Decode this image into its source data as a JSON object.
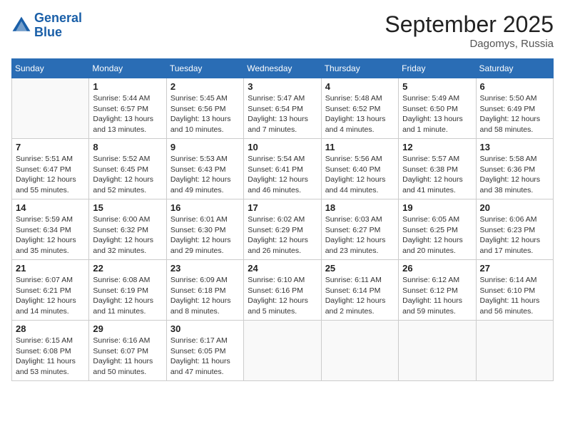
{
  "header": {
    "logo_line1": "General",
    "logo_line2": "Blue",
    "month": "September 2025",
    "location": "Dagomys, Russia"
  },
  "weekdays": [
    "Sunday",
    "Monday",
    "Tuesday",
    "Wednesday",
    "Thursday",
    "Friday",
    "Saturday"
  ],
  "weeks": [
    [
      {
        "day": "",
        "sunrise": "",
        "sunset": "",
        "daylight": ""
      },
      {
        "day": "1",
        "sunrise": "Sunrise: 5:44 AM",
        "sunset": "Sunset: 6:57 PM",
        "daylight": "Daylight: 13 hours and 13 minutes."
      },
      {
        "day": "2",
        "sunrise": "Sunrise: 5:45 AM",
        "sunset": "Sunset: 6:56 PM",
        "daylight": "Daylight: 13 hours and 10 minutes."
      },
      {
        "day": "3",
        "sunrise": "Sunrise: 5:47 AM",
        "sunset": "Sunset: 6:54 PM",
        "daylight": "Daylight: 13 hours and 7 minutes."
      },
      {
        "day": "4",
        "sunrise": "Sunrise: 5:48 AM",
        "sunset": "Sunset: 6:52 PM",
        "daylight": "Daylight: 13 hours and 4 minutes."
      },
      {
        "day": "5",
        "sunrise": "Sunrise: 5:49 AM",
        "sunset": "Sunset: 6:50 PM",
        "daylight": "Daylight: 13 hours and 1 minute."
      },
      {
        "day": "6",
        "sunrise": "Sunrise: 5:50 AM",
        "sunset": "Sunset: 6:49 PM",
        "daylight": "Daylight: 12 hours and 58 minutes."
      }
    ],
    [
      {
        "day": "7",
        "sunrise": "Sunrise: 5:51 AM",
        "sunset": "Sunset: 6:47 PM",
        "daylight": "Daylight: 12 hours and 55 minutes."
      },
      {
        "day": "8",
        "sunrise": "Sunrise: 5:52 AM",
        "sunset": "Sunset: 6:45 PM",
        "daylight": "Daylight: 12 hours and 52 minutes."
      },
      {
        "day": "9",
        "sunrise": "Sunrise: 5:53 AM",
        "sunset": "Sunset: 6:43 PM",
        "daylight": "Daylight: 12 hours and 49 minutes."
      },
      {
        "day": "10",
        "sunrise": "Sunrise: 5:54 AM",
        "sunset": "Sunset: 6:41 PM",
        "daylight": "Daylight: 12 hours and 46 minutes."
      },
      {
        "day": "11",
        "sunrise": "Sunrise: 5:56 AM",
        "sunset": "Sunset: 6:40 PM",
        "daylight": "Daylight: 12 hours and 44 minutes."
      },
      {
        "day": "12",
        "sunrise": "Sunrise: 5:57 AM",
        "sunset": "Sunset: 6:38 PM",
        "daylight": "Daylight: 12 hours and 41 minutes."
      },
      {
        "day": "13",
        "sunrise": "Sunrise: 5:58 AM",
        "sunset": "Sunset: 6:36 PM",
        "daylight": "Daylight: 12 hours and 38 minutes."
      }
    ],
    [
      {
        "day": "14",
        "sunrise": "Sunrise: 5:59 AM",
        "sunset": "Sunset: 6:34 PM",
        "daylight": "Daylight: 12 hours and 35 minutes."
      },
      {
        "day": "15",
        "sunrise": "Sunrise: 6:00 AM",
        "sunset": "Sunset: 6:32 PM",
        "daylight": "Daylight: 12 hours and 32 minutes."
      },
      {
        "day": "16",
        "sunrise": "Sunrise: 6:01 AM",
        "sunset": "Sunset: 6:30 PM",
        "daylight": "Daylight: 12 hours and 29 minutes."
      },
      {
        "day": "17",
        "sunrise": "Sunrise: 6:02 AM",
        "sunset": "Sunset: 6:29 PM",
        "daylight": "Daylight: 12 hours and 26 minutes."
      },
      {
        "day": "18",
        "sunrise": "Sunrise: 6:03 AM",
        "sunset": "Sunset: 6:27 PM",
        "daylight": "Daylight: 12 hours and 23 minutes."
      },
      {
        "day": "19",
        "sunrise": "Sunrise: 6:05 AM",
        "sunset": "Sunset: 6:25 PM",
        "daylight": "Daylight: 12 hours and 20 minutes."
      },
      {
        "day": "20",
        "sunrise": "Sunrise: 6:06 AM",
        "sunset": "Sunset: 6:23 PM",
        "daylight": "Daylight: 12 hours and 17 minutes."
      }
    ],
    [
      {
        "day": "21",
        "sunrise": "Sunrise: 6:07 AM",
        "sunset": "Sunset: 6:21 PM",
        "daylight": "Daylight: 12 hours and 14 minutes."
      },
      {
        "day": "22",
        "sunrise": "Sunrise: 6:08 AM",
        "sunset": "Sunset: 6:19 PM",
        "daylight": "Daylight: 12 hours and 11 minutes."
      },
      {
        "day": "23",
        "sunrise": "Sunrise: 6:09 AM",
        "sunset": "Sunset: 6:18 PM",
        "daylight": "Daylight: 12 hours and 8 minutes."
      },
      {
        "day": "24",
        "sunrise": "Sunrise: 6:10 AM",
        "sunset": "Sunset: 6:16 PM",
        "daylight": "Daylight: 12 hours and 5 minutes."
      },
      {
        "day": "25",
        "sunrise": "Sunrise: 6:11 AM",
        "sunset": "Sunset: 6:14 PM",
        "daylight": "Daylight: 12 hours and 2 minutes."
      },
      {
        "day": "26",
        "sunrise": "Sunrise: 6:12 AM",
        "sunset": "Sunset: 6:12 PM",
        "daylight": "Daylight: 11 hours and 59 minutes."
      },
      {
        "day": "27",
        "sunrise": "Sunrise: 6:14 AM",
        "sunset": "Sunset: 6:10 PM",
        "daylight": "Daylight: 11 hours and 56 minutes."
      }
    ],
    [
      {
        "day": "28",
        "sunrise": "Sunrise: 6:15 AM",
        "sunset": "Sunset: 6:08 PM",
        "daylight": "Daylight: 11 hours and 53 minutes."
      },
      {
        "day": "29",
        "sunrise": "Sunrise: 6:16 AM",
        "sunset": "Sunset: 6:07 PM",
        "daylight": "Daylight: 11 hours and 50 minutes."
      },
      {
        "day": "30",
        "sunrise": "Sunrise: 6:17 AM",
        "sunset": "Sunset: 6:05 PM",
        "daylight": "Daylight: 11 hours and 47 minutes."
      },
      {
        "day": "",
        "sunrise": "",
        "sunset": "",
        "daylight": ""
      },
      {
        "day": "",
        "sunrise": "",
        "sunset": "",
        "daylight": ""
      },
      {
        "day": "",
        "sunrise": "",
        "sunset": "",
        "daylight": ""
      },
      {
        "day": "",
        "sunrise": "",
        "sunset": "",
        "daylight": ""
      }
    ]
  ]
}
